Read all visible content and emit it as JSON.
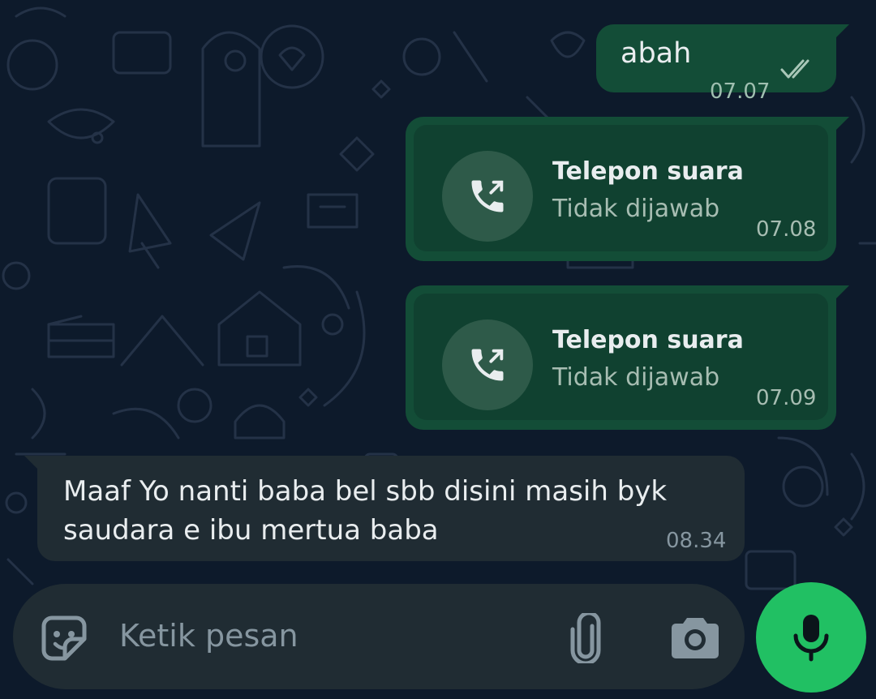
{
  "colors": {
    "background": "#0d1a2b",
    "outgoing_bubble": "#134d37",
    "incoming_bubble": "#202c33",
    "accent": "#21c063"
  },
  "messages": [
    {
      "direction": "outgoing",
      "type": "text",
      "text": "abah",
      "time": "07.07",
      "status_icon": "double-check-icon"
    },
    {
      "direction": "outgoing",
      "type": "voice_call",
      "title": "Telepon suara",
      "status": "Tidak dijawab",
      "time": "07.08",
      "icon": "outgoing-call-icon"
    },
    {
      "direction": "outgoing",
      "type": "voice_call",
      "title": "Telepon suara",
      "status": "Tidak dijawab",
      "time": "07.09",
      "icon": "outgoing-call-icon"
    },
    {
      "direction": "incoming",
      "type": "text",
      "text": "Maaf Yo nanti baba bel sbb disini masih byk saudara e ibu mertua baba",
      "time": "08.34"
    }
  ],
  "composer": {
    "placeholder": "Ketik pesan",
    "emoji_icon": "sticker-icon",
    "attach_icon": "paperclip-icon",
    "camera_icon": "camera-icon",
    "mic_icon": "microphone-icon"
  }
}
